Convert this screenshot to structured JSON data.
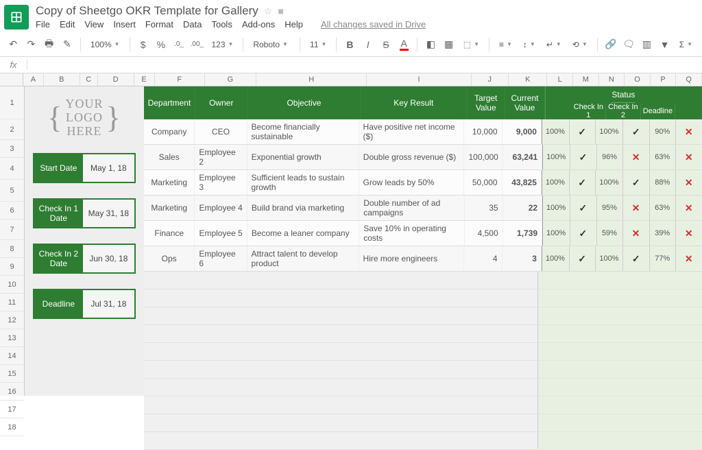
{
  "doc_title": "Copy of Sheetgo OKR Template for Gallery",
  "menus": [
    "File",
    "Edit",
    "View",
    "Insert",
    "Format",
    "Data",
    "Tools",
    "Add-ons",
    "Help"
  ],
  "save_status": "All changes saved in Drive",
  "toolbar": {
    "zoom": "100%",
    "font": "Roboto",
    "font_size": "11",
    "currency": "$",
    "percent": "%",
    "decimals": ".0_",
    "decimals2": ".00_",
    "more_formats": "123"
  },
  "fx_label": "fx",
  "cols": [
    "A",
    "B",
    "C",
    "D",
    "E",
    "F",
    "G",
    "H",
    "I",
    "J",
    "K",
    "L",
    "M",
    "N",
    "O",
    "P",
    "Q"
  ],
  "rows_n": 18,
  "logo": {
    "l1": "YOUR",
    "l2": "LOGO",
    "l3": "HERE"
  },
  "dates": [
    {
      "label": "Start Date",
      "value": "May 1, 18"
    },
    {
      "label": "Check In 1 Date",
      "value": "May 31, 18"
    },
    {
      "label": "Check In 2 Date",
      "value": "Jun 30, 18"
    },
    {
      "label": "Deadline",
      "value": "Jul 31, 18"
    }
  ],
  "table": {
    "headers": {
      "department": "Department",
      "owner": "Owner",
      "objective": "Objective",
      "key_result": "Key Result",
      "target": "Target Value",
      "current": "Current Value",
      "status": "Status",
      "check1": "Check In 1",
      "check2": "Check In 2",
      "deadline": "Deadline"
    },
    "rows": [
      {
        "dept": "Company",
        "owner": "CEO",
        "obj": "Become financially sustainable",
        "kr": "Have positive net income ($)",
        "tv": "10,000",
        "cv": "9,000",
        "c1p": "100%",
        "c1": "✓",
        "c2p": "100%",
        "c2": "✓",
        "dp": "90%",
        "d": "✕"
      },
      {
        "dept": "Sales",
        "owner": "Employee 2",
        "obj": "Exponential growth",
        "kr": "Double gross revenue ($)",
        "tv": "100,000",
        "cv": "63,241",
        "c1p": "100%",
        "c1": "✓",
        "c2p": "96%",
        "c2": "✕",
        "dp": "63%",
        "d": "✕"
      },
      {
        "dept": "Marketing",
        "owner": "Employee 3",
        "obj": "Sufficient leads to sustain growth",
        "kr": "Grow leads by 50%",
        "tv": "50,000",
        "cv": "43,825",
        "c1p": "100%",
        "c1": "✓",
        "c2p": "100%",
        "c2": "✓",
        "dp": "88%",
        "d": "✕"
      },
      {
        "dept": "Marketing",
        "owner": "Employee 4",
        "obj": "Build brand via marketing",
        "kr": "Double number of ad campaigns",
        "tv": "35",
        "cv": "22",
        "c1p": "100%",
        "c1": "✓",
        "c2p": "95%",
        "c2": "✕",
        "dp": "63%",
        "d": "✕"
      },
      {
        "dept": "Finance",
        "owner": "Employee 5",
        "obj": "Become a leaner company",
        "kr": "Save 10% in operating costs",
        "tv": "4,500",
        "cv": "1,739",
        "c1p": "100%",
        "c1": "✓",
        "c2p": "59%",
        "c2": "✕",
        "dp": "39%",
        "d": "✕"
      },
      {
        "dept": "Ops",
        "owner": "Employee 6",
        "obj": "Attract talent to develop product",
        "kr": "Hire more engineers",
        "tv": "4",
        "cv": "3",
        "c1p": "100%",
        "c1": "✓",
        "c2p": "100%",
        "c2": "✓",
        "dp": "77%",
        "d": "✕"
      }
    ]
  }
}
